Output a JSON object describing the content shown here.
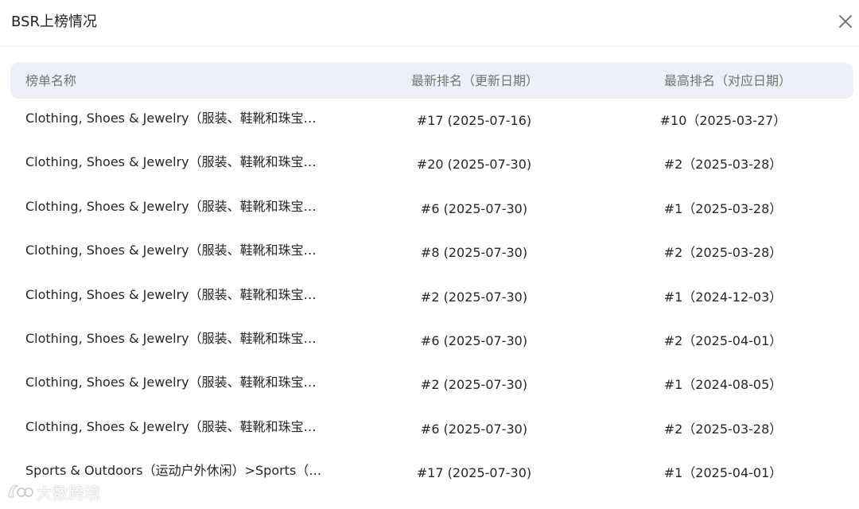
{
  "dialog": {
    "title": "BSR上榜情况",
    "close_icon": "close-icon"
  },
  "table": {
    "headers": {
      "name": "榜单名称",
      "latest": "最新排名（更新日期）",
      "best": "最高排名（对应日期）"
    },
    "rows": [
      {
        "name": "Clothing, Shoes & Jewelry（服装、鞋靴和珠宝饰品）",
        "latest": "#17 (2025-07-16)",
        "best": "#10（2025-03-27）"
      },
      {
        "name": "Clothing, Shoes & Jewelry（服装、鞋靴和珠宝饰品...",
        "latest": "#20 (2025-07-30)",
        "best": "#2（2025-03-28）"
      },
      {
        "name": "Clothing, Shoes & Jewelry（服装、鞋靴和珠宝饰品...",
        "latest": "#6 (2025-07-30)",
        "best": "#1（2025-03-28）"
      },
      {
        "name": "Clothing, Shoes & Jewelry（服装、鞋靴和珠宝饰品...",
        "latest": "#8 (2025-07-30)",
        "best": "#2（2025-03-28）"
      },
      {
        "name": "Clothing, Shoes & Jewelry（服装、鞋靴和珠宝饰品...",
        "latest": "#2 (2025-07-30)",
        "best": "#1（2024-12-03）"
      },
      {
        "name": "Clothing, Shoes & Jewelry（服装、鞋靴和珠宝饰品...",
        "latest": "#6 (2025-07-30)",
        "best": "#2（2025-04-01）"
      },
      {
        "name": "Clothing, Shoes & Jewelry（服装、鞋靴和珠宝饰品...",
        "latest": "#2 (2025-07-30)",
        "best": "#1（2024-08-05）"
      },
      {
        "name": "Clothing, Shoes & Jewelry（服装、鞋靴和珠宝饰品...",
        "latest": "#6 (2025-07-30)",
        "best": "#2（2025-03-28）"
      },
      {
        "name": "Sports & Outdoors（运动户外休闲）>Sports（运动...",
        "latest": "#17 (2025-07-30)",
        "best": "#1（2025-04-01）"
      }
    ]
  },
  "watermark": {
    "text": "大数跨境"
  }
}
